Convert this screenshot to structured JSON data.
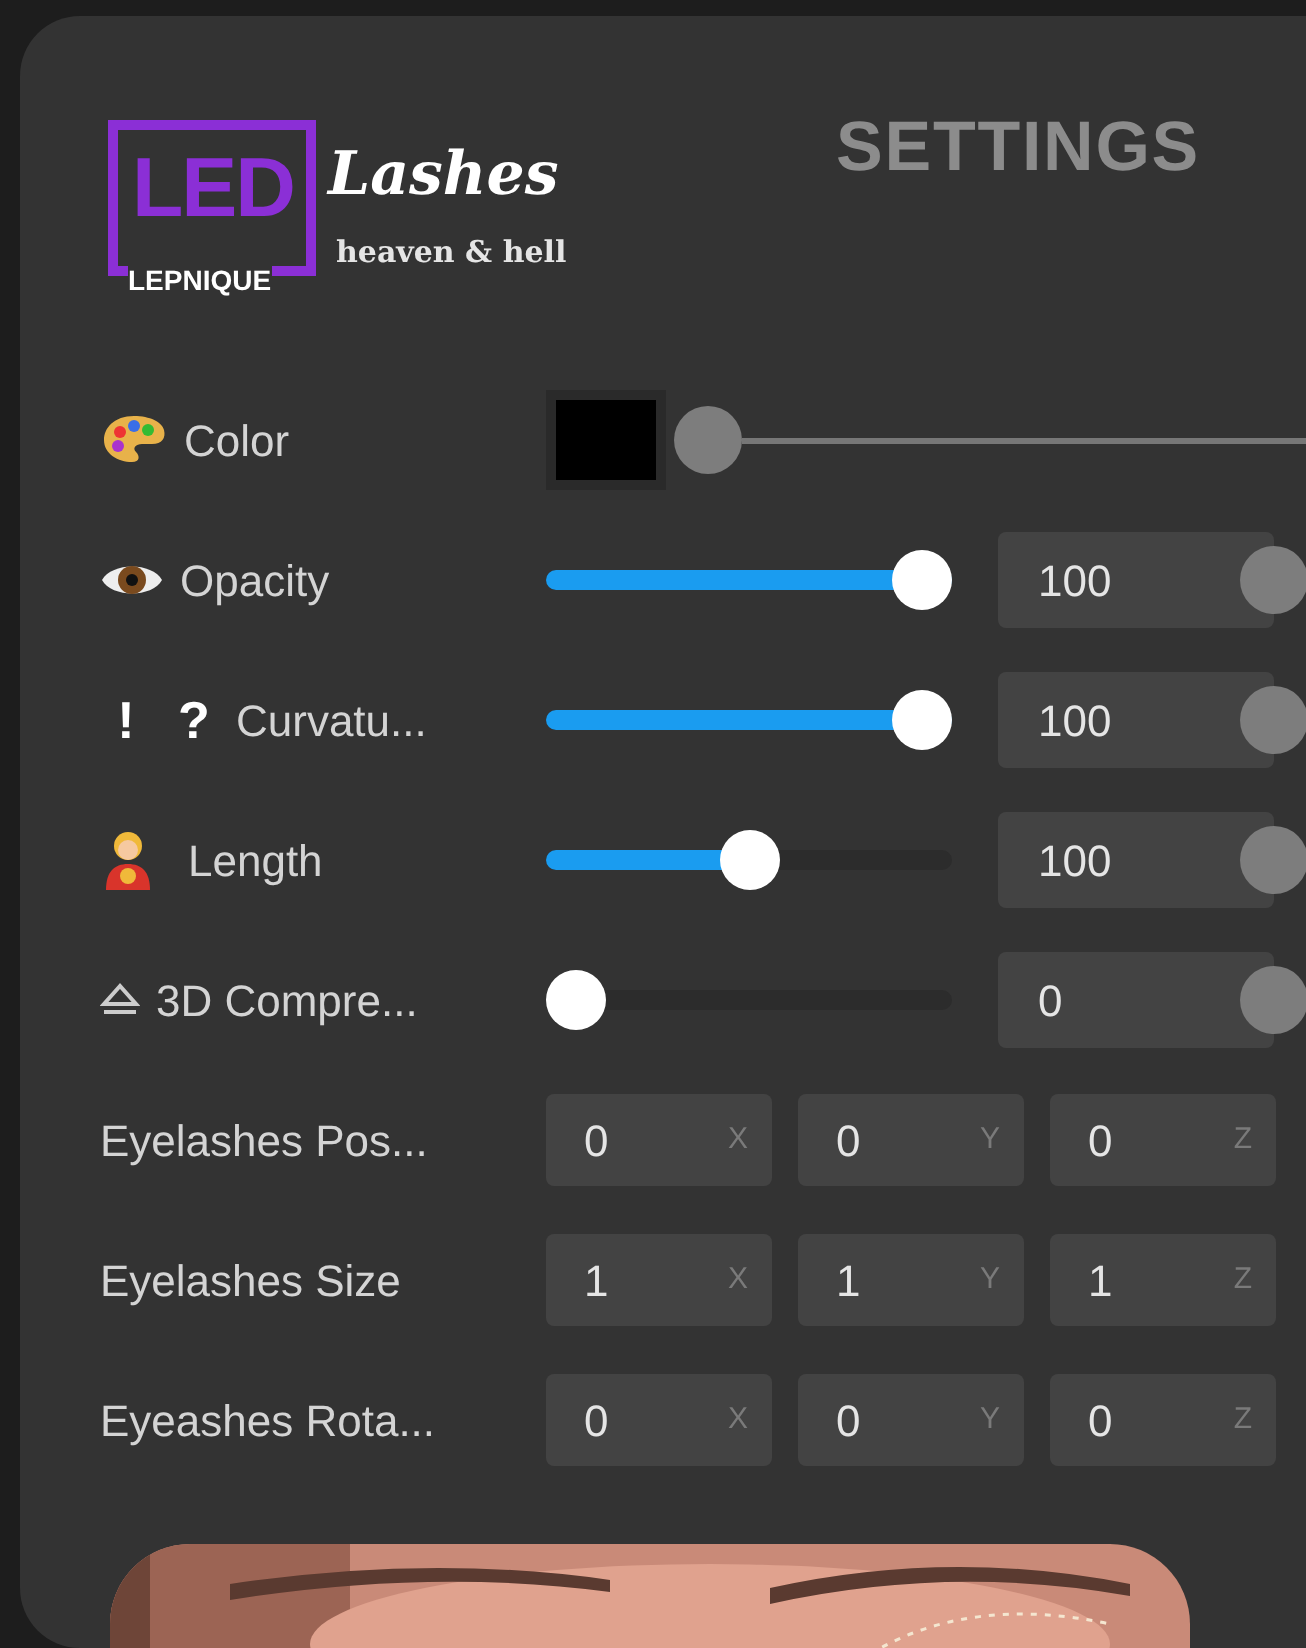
{
  "logo": {
    "mark": "LED",
    "script": "Lashes",
    "byline": "LEPNIQUE",
    "tagline": "heaven & hell"
  },
  "title": "SETTINGS",
  "rows": [
    {
      "kind": "color",
      "label": "Color",
      "color": "#000000"
    },
    {
      "kind": "slider",
      "label": "Opacity",
      "level": 1.0,
      "value": "100"
    },
    {
      "kind": "slider",
      "label": "Curvatu...",
      "glyphs": [
        "!",
        "?"
      ],
      "level": 1.0,
      "value": "100"
    },
    {
      "kind": "slider",
      "label": "Length",
      "level": 0.5,
      "value": "100"
    },
    {
      "kind": "slider",
      "label": "3D Compre...",
      "level": 0.0,
      "value": "0"
    },
    {
      "kind": "vector",
      "label": "Eyelashes Pos...",
      "fields": [
        {
          "value": "0",
          "axis": "X"
        },
        {
          "value": "0",
          "axis": "Y"
        },
        {
          "value": "0",
          "axis": "Z"
        }
      ]
    },
    {
      "kind": "vector",
      "label": "Eyelashes Size",
      "fields": [
        {
          "value": "1",
          "axis": "X"
        },
        {
          "value": "1",
          "axis": "Y"
        },
        {
          "value": "1",
          "axis": "Z"
        }
      ]
    },
    {
      "kind": "vector",
      "label": "Eyeashes Rota...",
      "fields": [
        {
          "value": "0",
          "axis": "X"
        },
        {
          "value": "0",
          "axis": "Y"
        },
        {
          "value": "0",
          "axis": "Z"
        }
      ]
    }
  ]
}
